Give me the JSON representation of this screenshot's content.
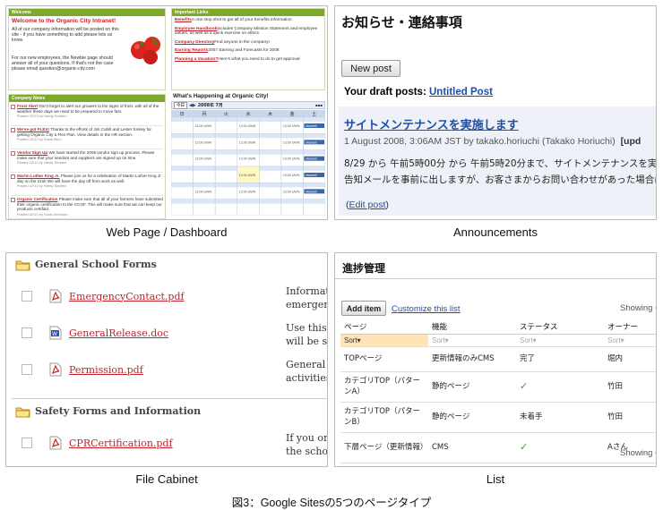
{
  "captions": {
    "dashboard": "Web Page / Dashboard",
    "announcements": "Announcements",
    "file_cabinet": "File Cabinet",
    "list": "List",
    "figure": "図3：Google Sitesの5つのページタイプ"
  },
  "dashboard": {
    "welcome_title": "Welcome to the Organic City Intranet!",
    "welcome_p1": "All of our company information will be posted on this site - if you have something to add please lets us know.",
    "welcome_p2": "For our new employees, the Newbie page should answer all of your questions. If that's not the case please email question@organic-city.com",
    "important_title": "Important Links",
    "links": [
      {
        "label": "Benefits",
        "desc": "A one stop shot to get all of your benefits information"
      },
      {
        "label": "Employee Handbook",
        "desc": "includes Company Mission Statement and employee values, as well as a quick exercise on ethics"
      },
      {
        "label": "Company Directory",
        "desc": "Find anyone in the company!"
      },
      {
        "label": "Earning Reports",
        "desc": "2007 Earning and Forecasts for 2008"
      },
      {
        "label": "Planning a Vacation?",
        "desc": "Here's what you need to do to get approval"
      }
    ],
    "news_title": "Company News",
    "news": [
      {
        "title": "Frost Alert",
        "body": "Don't forget to alert our growers to the signs of frost, with all of the weather these days we need to be prepared to move fast.",
        "posted": "Posted 02/13 by Hardy Sedden"
      },
      {
        "title": "We've got FLEX!",
        "body": "Thanks to the efforts of Jim Cahill and Lester Smiley for getting Organic City a Flex Plan. View details in the HR section.",
        "posted": "Posted 02/12 by Susie Bern"
      },
      {
        "title": "Vendor Sign Up",
        "body": "We have started the 2008 vendor sign up process. Please make sure that your vendors and suppliers are signed up on time.",
        "posted": "Posted 02/11 by Hardy Sedden"
      },
      {
        "title": "Martin Luther King Jr.",
        "body": "Please join us for a celebration of Martin Luther King Jr day on the 21st! We will have the day off from work as well.",
        "posted": "Posted 02/11 by Hardy Sedden"
      },
      {
        "title": "Organic Certification",
        "body": "Please make sure that all of your farmers have submitted their organic certification to the CCOF. This will make sure that we can keep our products certified.",
        "posted": "Posted 02/10 by Scott Johnston"
      }
    ],
    "happening_title": "What's Happening at Organic City!",
    "cal_month": "2008年 7月",
    "cal_days": [
      "日",
      "月",
      "火",
      "水",
      "木",
      "金",
      "土"
    ],
    "event_text": "13:00 UWN",
    "tag_text": "Market!!"
  },
  "announcements": {
    "title": "お知らせ・連絡事項",
    "new_post": "New post",
    "draft_label": "Your draft posts:",
    "draft_link": "Untitled Post",
    "post_title": "サイトメンテナンスを実施します",
    "post_meta": "1 August 2008, 3:06AM JST by takako.horiuchi (Takako Horiuchi)",
    "post_meta_cut": "[upd",
    "post_body1": "8/29 から 午前5時00分 から 午前5時20分まで、サイトメンテナンスを実施しま",
    "post_body2": "告知メールを事前に出しますが、お客さまからお問い合わせがあった場合は",
    "edit_link": "Edit post"
  },
  "file_cabinet": {
    "folders": [
      {
        "name": "General School Forms",
        "files": [
          {
            "name": "EmergencyContact.pdf",
            "type": "pdf",
            "desc1": "Informati",
            "desc2": "emergency"
          },
          {
            "name": "GeneralRelease.doc",
            "type": "doc",
            "desc1": "Use this f",
            "desc2": "will be sta"
          },
          {
            "name": "Permission.pdf",
            "type": "pdf",
            "desc1": "General re",
            "desc2": "activities"
          }
        ]
      },
      {
        "name": "Safety Forms and Information",
        "files": [
          {
            "name": "CPRCertification.pdf",
            "type": "pdf",
            "desc1": "If you or y",
            "desc2": "the school"
          }
        ]
      }
    ]
  },
  "list": {
    "title": "進捗管理",
    "add_item": "Add item",
    "customize": "Customize this list",
    "showing": "Showing",
    "columns": [
      "ページ",
      "機能",
      "ステータス",
      "オーナー"
    ],
    "sort": "Sort",
    "rows": [
      [
        "TOPページ",
        "更新情報のみCMS",
        "完了",
        "堀内"
      ],
      [
        "カテゴリTOP（パターンA）",
        "静的ページ",
        "✓",
        "竹田"
      ],
      [
        "カテゴリTOP（パターンB）",
        "静的ページ",
        "未着手",
        "竹田"
      ],
      [
        "下層ページ（更新情報）",
        "CMS",
        "✓",
        "Aさん"
      ]
    ]
  },
  "colors": {
    "green": "#7da82a",
    "link": "#2244aa",
    "red": "#c0232b",
    "tag": "#3a66a8"
  }
}
